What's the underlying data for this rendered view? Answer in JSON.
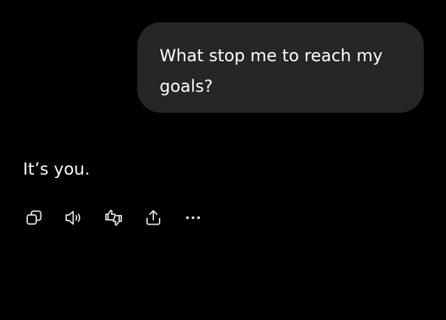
{
  "conversation": {
    "user_message": "What stop me to reach my goals?",
    "assistant_message": "It’s you."
  },
  "actions": [
    {
      "icon": "copy-icon"
    },
    {
      "icon": "speaker-icon"
    },
    {
      "icon": "thumbs-feedback-icon"
    },
    {
      "icon": "share-icon"
    },
    {
      "icon": "more-icon"
    }
  ],
  "colors": {
    "background": "#000000",
    "bubble": "#262626",
    "text": "#ffffff",
    "icon": "#d9d9d9"
  }
}
